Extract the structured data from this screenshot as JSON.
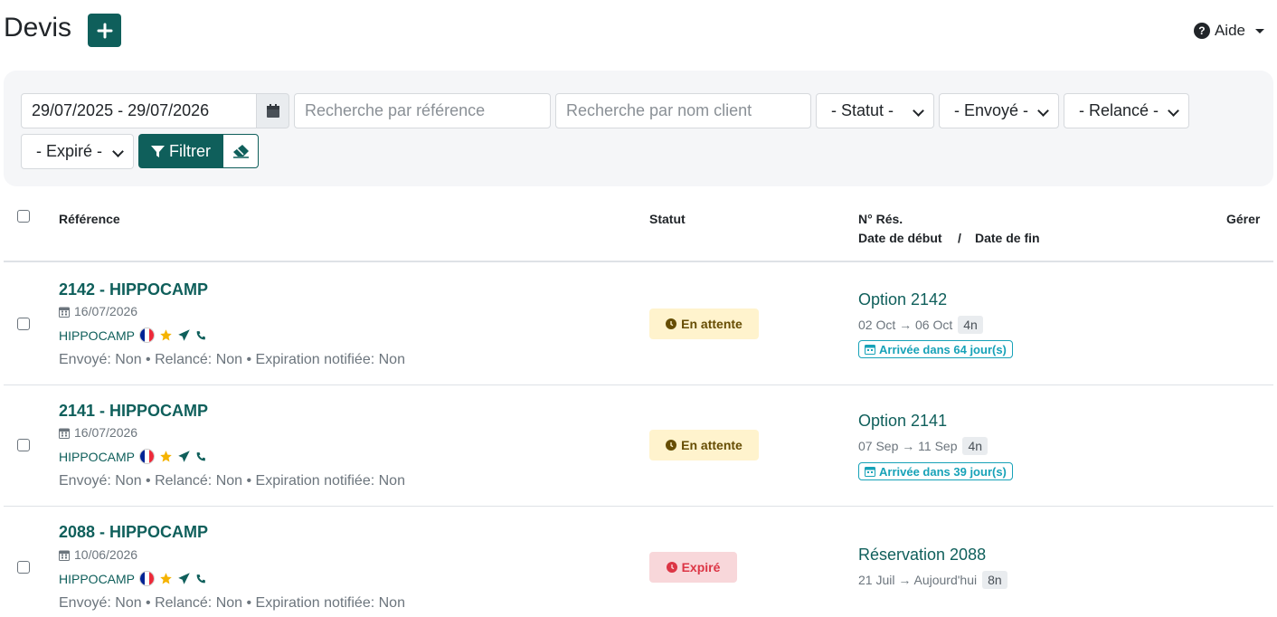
{
  "header": {
    "title": "Devis",
    "help_label": "Aide"
  },
  "filters": {
    "date_range": "29/07/2025 - 29/07/2026",
    "ref_placeholder": "Recherche par référence",
    "client_placeholder": "Recherche par nom client",
    "status": "- Statut -",
    "sent": "- Envoyé -",
    "reminded": "- Relancé -",
    "expired": "- Expiré -",
    "filter_label": "Filtrer"
  },
  "table": {
    "col_reference": "Référence",
    "col_status": "Statut",
    "col_booking": "N° Rés.",
    "col_start": "Date de début",
    "col_sep": "/",
    "col_end": "Date de fin",
    "col_manage": "Gérer"
  },
  "rows": [
    {
      "ref": "2142 - HIPPOCAMP",
      "date": "16/07/2026",
      "client": "HIPPOCAMP",
      "meta": "Envoyé: Non • Relancé: Non • Expiration notifiée: Non",
      "status": "En attente",
      "option": "Option 2142",
      "range": "02 Oct → 06 Oct",
      "nights": "4n",
      "arrival": "Arrivée dans 64 jour(s)"
    },
    {
      "ref": "2141 - HIPPOCAMP",
      "date": "16/07/2026",
      "client": "HIPPOCAMP",
      "meta": "Envoyé: Non • Relancé: Non • Expiration notifiée: Non",
      "status": "En attente",
      "option": "Option 2141",
      "range": "07 Sep → 11 Sep",
      "nights": "4n",
      "arrival": "Arrivée dans 39 jour(s)"
    },
    {
      "ref": "2088 - HIPPOCAMP",
      "date": "10/06/2026",
      "client": "HIPPOCAMP",
      "meta": "Envoyé: Non • Relancé: Non • Expiration notifiée: Non",
      "status": "Expiré",
      "option": "Réservation 2088",
      "range": "21 Juil → Aujourd'hui",
      "nights": "8n"
    }
  ],
  "colors": {
    "brand": "#0f5f5b",
    "waiting_bg": "#fff3cd",
    "expired_bg": "#f8d7da",
    "info": "#17a2b8"
  }
}
